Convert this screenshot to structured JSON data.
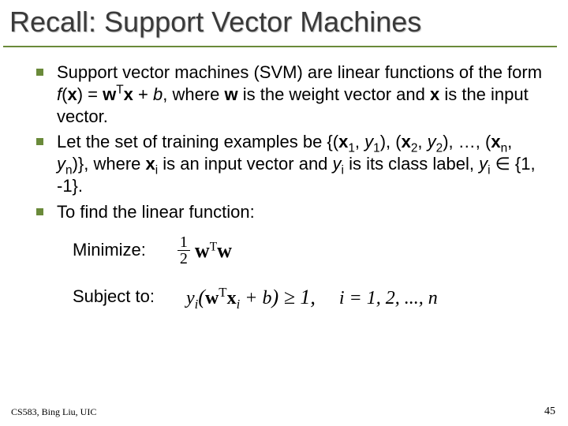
{
  "title": "Recall: Support Vector Machines",
  "bullets": {
    "b1_a": "Support vector machines (SVM) are linear functions of the form ",
    "b1_fx": "f",
    "b1_x1": "x",
    "b1_eq": ") = ",
    "b1_w1": "w",
    "b1_T": "T",
    "b1_x2": "x",
    "b1_plusb": " + ",
    "b1_b": "b",
    "b1_mid": ", where ",
    "b1_w2": "w",
    "b1_mid2": " is the weight vector and ",
    "b1_x3": "x",
    "b1_end": " is the input vector.",
    "b2_a": "Let the set of training examples be {(",
    "b2_x": "x",
    "b2_y": "y",
    "b2_after_x1": ", ",
    "b2_after_y1": "), (",
    "b2_after_y2": "), …, (",
    "b2_after_yn": ")}, where ",
    "b2_mid": " is an input vector and ",
    "b2_mid2": " is its class label, ",
    "b2_in": " ∈ {1, -1}.",
    "b3": "To find the linear function:",
    "sub1": "1",
    "sub2": "2",
    "subn": "n",
    "subi": "i"
  },
  "labels": {
    "minimize": "Minimize:",
    "subject": "Subject to:"
  },
  "eq_min": {
    "half_num": "1",
    "half_den": "2",
    "w": "w",
    "T": "T"
  },
  "eq_con": {
    "y": "y",
    "i": "i",
    "w": "w",
    "T": "T",
    "x": "x",
    "b": "b",
    "ge1": ") ≥ 1,",
    "plus": " + ",
    "open": "(",
    "range": "i = 1, 2, ..., n"
  },
  "footer": {
    "left": "CS583, Bing Liu, UIC",
    "right": "45"
  }
}
